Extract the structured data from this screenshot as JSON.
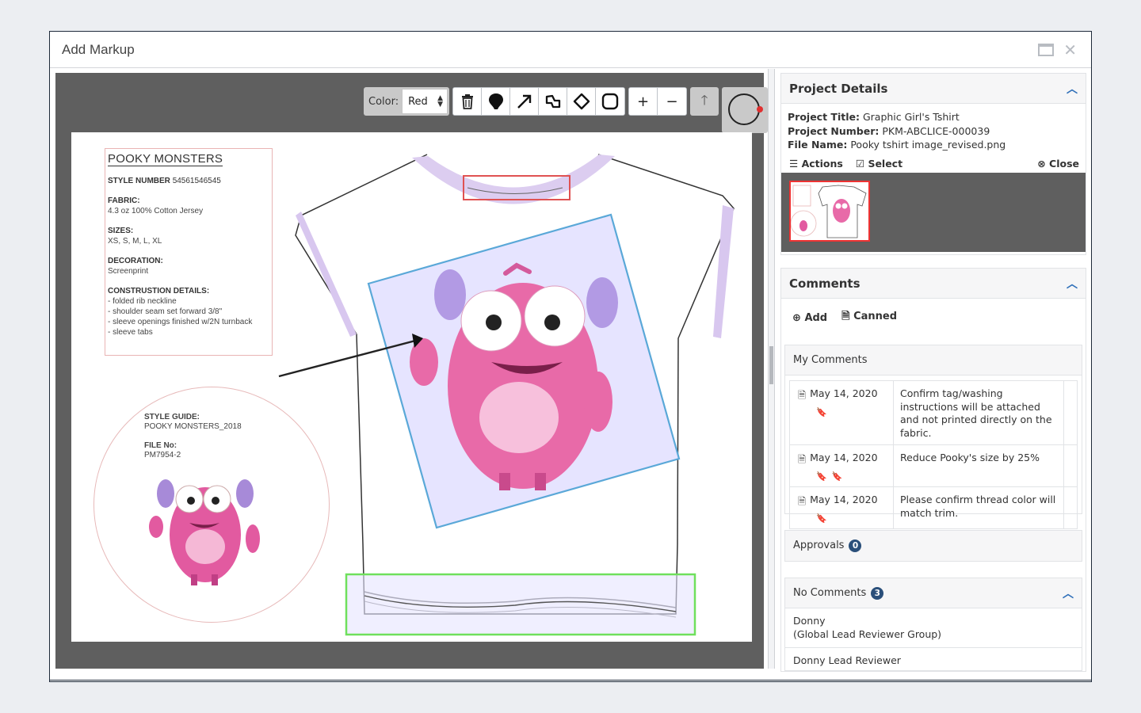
{
  "dialog": {
    "title": "Add Markup"
  },
  "toolbar": {
    "color_label": "Color:",
    "color_value": "Red",
    "tools": [
      "trash-icon",
      "pin-icon",
      "arrow-icon",
      "freehand-icon",
      "ellipse-icon",
      "rectangle-icon"
    ],
    "zoom_in": "+",
    "zoom_out": "−"
  },
  "sheet": {
    "spec_title": "POOKY MONSTERS",
    "style_number_label": "STYLE NUMBER",
    "style_number": "54561546545",
    "fabric_label": "FABRIC:",
    "fabric": "4.3 oz 100% Cotton Jersey",
    "sizes_label": "SIZES:",
    "sizes": "XS, S, M, L, XL",
    "decoration_label": "DECORATION:",
    "decoration": "Screenprint",
    "construction_label": "CONSTRUSTION DETAILS:",
    "construction": [
      "- folded rib neckline",
      "- shoulder seam set forward 3/8\"",
      "- sleeve openings finished w/2N turnback",
      "- sleeve tabs"
    ],
    "guide_label": "STYLE GUIDE:",
    "guide": "POOKY MONSTERS_2018",
    "file_no_label": "FILE No:",
    "file_no": "PM7954-2"
  },
  "project": {
    "header": "Project Details",
    "title_label": "Project Title:",
    "title": "Graphic Girl's Tshirt",
    "number_label": "Project Number:",
    "number": "PKM-ABCLICE-000039",
    "file_label": "File Name:",
    "file": "Pooky tshirt image_revised.png",
    "actions": "Actions",
    "select": "Select",
    "close": "Close"
  },
  "comments": {
    "header": "Comments",
    "add": "Add",
    "canned": "Canned",
    "my_comments": "My Comments",
    "items": [
      {
        "date": "May 14, 2020",
        "text": "Confirm tag/washing instructions will be attached and not printed directly on the fabric.",
        "bookmarks": "1"
      },
      {
        "date": "May 14, 2020",
        "text": "Reduce Pooky's size by 25%",
        "bookmarks": "2"
      },
      {
        "date": "May 14, 2020",
        "text": "Please confirm thread color will match trim.",
        "bookmarks": "1"
      }
    ],
    "approvals": "Approvals",
    "approvals_count": "0",
    "no_comments": "No Comments",
    "no_comments_count": "3",
    "reviewers": [
      {
        "name": "Donny",
        "group": "(Global Lead Reviewer Group)"
      },
      {
        "name": "Donny Lead Reviewer",
        "group": ""
      }
    ]
  },
  "colors": {
    "accent": "#2f6fb8",
    "badge": "#2a4f7a",
    "markup_red": "#e05252",
    "markup_blue": "#5aa8d8",
    "markup_green": "#6fe05c",
    "canvas": "#5f5f5f"
  }
}
